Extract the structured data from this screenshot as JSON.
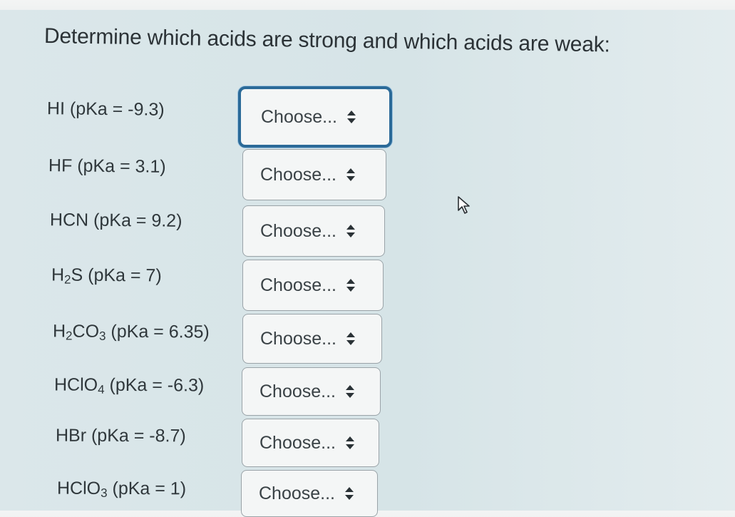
{
  "question": {
    "title": "Determine which acids are strong and which acids are weak:"
  },
  "rows": [
    {
      "formula_html": "HI (pKa = -9.3)",
      "formula_parts": [
        "HI (pKa = -9.3)"
      ],
      "select_value": "Choose..."
    },
    {
      "formula_parts": [
        "HF (pKa = 3.1)"
      ],
      "select_value": "Choose..."
    },
    {
      "formula_parts": [
        "HCN (pKa = 9.2)"
      ],
      "select_value": "Choose..."
    },
    {
      "formula_parts": [
        "H",
        "2",
        "S (pKa = 7)"
      ],
      "select_value": "Choose..."
    },
    {
      "formula_parts": [
        "H",
        "2",
        "CO",
        "3",
        " (pKa = 6.35)"
      ],
      "select_value": "Choose..."
    },
    {
      "formula_parts": [
        "HClO",
        "4",
        " (pKa = -6.3)"
      ],
      "select_value": "Choose..."
    },
    {
      "formula_parts": [
        "HBr (pKa = -8.7)"
      ],
      "select_value": "Choose..."
    },
    {
      "formula_parts": [
        "HClO",
        "3",
        " (pKa = 1)"
      ],
      "select_value": "Choose..."
    }
  ],
  "icons": {
    "select_arrows": "up-down-arrows-icon",
    "pointer": "mouse-cursor-icon"
  },
  "colors": {
    "focus_border": "#2b6a98",
    "background": "#d8e5e8"
  }
}
